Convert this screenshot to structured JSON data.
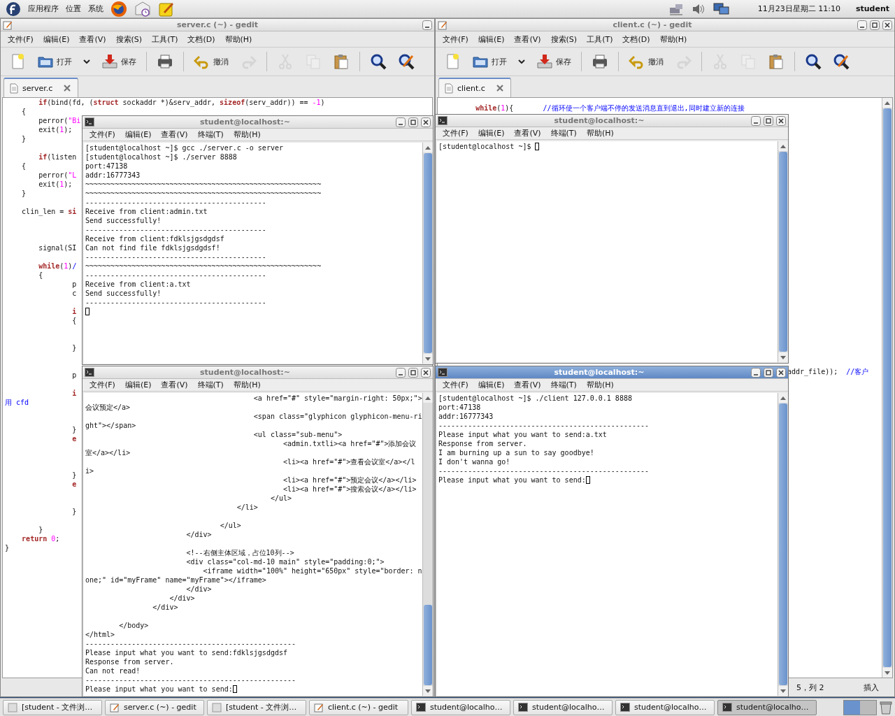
{
  "top_panel": {
    "menus": [
      "应用程序",
      "位置",
      "系统"
    ],
    "launchers": [
      {
        "kind": "browser"
      },
      {
        "kind": "mail"
      },
      {
        "kind": "notes"
      }
    ],
    "tray": [
      {
        "kind": "network"
      },
      {
        "kind": "volume"
      },
      {
        "kind": "display"
      }
    ],
    "clock": "11月23日星期二 11:10",
    "user": "student"
  },
  "gedit_windows": [
    {
      "title": "server.c (~) - gedit",
      "controls": [
        {
          "kind": "minimize"
        }
      ],
      "menus": [
        "文件(F)",
        "编辑(E)",
        "查看(V)",
        "搜索(S)",
        "工具(T)",
        "文档(D)",
        "帮助(H)"
      ],
      "toolbar": [
        [
          {
            "kind": "new",
            "disabled": false
          },
          {
            "kind": "open",
            "label": "打开",
            "disabled": false
          },
          {
            "kind": "dropdown",
            "disabled": false
          },
          {
            "kind": "save",
            "label": "保存",
            "disabled": false
          }
        ],
        [
          {
            "kind": "print",
            "disabled": false
          }
        ],
        [
          {
            "kind": "undo",
            "label": "撤消",
            "disabled": false
          },
          {
            "kind": "redo",
            "disabled": true
          }
        ],
        [
          {
            "kind": "cut",
            "disabled": true
          },
          {
            "kind": "copy",
            "disabled": true
          },
          {
            "kind": "paste",
            "disabled": false
          }
        ],
        [
          {
            "kind": "find",
            "disabled": false
          },
          {
            "kind": "replace",
            "disabled": false
          }
        ]
      ],
      "tab": {
        "label": "server.c"
      },
      "code": [
        {
          "kind": "code",
          "segments": [
            {
              "kind": "keyword",
              "text": "        if"
            },
            {
              "kind": "plain",
              "text": "(bind(fd, ("
            },
            {
              "kind": "keyword",
              "text": "struct"
            },
            {
              "kind": "plain",
              "text": " sockaddr *)&serv_addr, "
            },
            {
              "kind": "keyword",
              "text": "sizeof"
            },
            {
              "kind": "plain",
              "text": "(serv_addr)) == "
            },
            {
              "kind": "number",
              "text": "-1"
            },
            {
              "kind": "plain",
              "text": ")"
            }
          ]
        },
        {
          "kind": "code",
          "segments": [
            {
              "kind": "plain",
              "text": "    {"
            }
          ]
        },
        {
          "kind": "code",
          "segments": [
            {
              "kind": "plain",
              "text": "        perror("
            },
            {
              "kind": "string",
              "text": "\"Bi"
            }
          ]
        },
        {
          "kind": "code",
          "segments": [
            {
              "kind": "plain",
              "text": "        exit("
            },
            {
              "kind": "number",
              "text": "1"
            },
            {
              "kind": "plain",
              "text": ");"
            }
          ]
        },
        {
          "kind": "code",
          "segments": [
            {
              "kind": "plain",
              "text": "    }"
            }
          ]
        },
        {
          "kind": "blank"
        },
        {
          "kind": "code",
          "segments": [
            {
              "kind": "keyword",
              "text": "        if"
            },
            {
              "kind": "plain",
              "text": "(listen"
            }
          ]
        },
        {
          "kind": "code",
          "segments": [
            {
              "kind": "plain",
              "text": "    {"
            }
          ]
        },
        {
          "kind": "code",
          "segments": [
            {
              "kind": "plain",
              "text": "        perror("
            },
            {
              "kind": "string",
              "text": "\"L"
            }
          ]
        },
        {
          "kind": "code",
          "segments": [
            {
              "kind": "plain",
              "text": "        exit("
            },
            {
              "kind": "number",
              "text": "1"
            },
            {
              "kind": "plain",
              "text": ");"
            }
          ]
        },
        {
          "kind": "code",
          "segments": [
            {
              "kind": "plain",
              "text": "    }"
            }
          ]
        },
        {
          "kind": "blank"
        },
        {
          "kind": "code",
          "segments": [
            {
              "kind": "plain",
              "text": "    clin_len = "
            },
            {
              "kind": "keyword",
              "text": "si"
            }
          ]
        },
        {
          "kind": "blank"
        },
        {
          "kind": "blank"
        },
        {
          "kind": "blank"
        },
        {
          "kind": "code",
          "segments": [
            {
              "kind": "plain",
              "text": "        signal(SI"
            }
          ]
        },
        {
          "kind": "blank"
        },
        {
          "kind": "code",
          "segments": [
            {
              "kind": "keyword",
              "text": "        while"
            },
            {
              "kind": "plain",
              "text": "("
            },
            {
              "kind": "number",
              "text": "1"
            },
            {
              "kind": "plain",
              "text": ")"
            },
            {
              "kind": "comment",
              "text": "/"
            }
          ]
        },
        {
          "kind": "code",
          "segments": [
            {
              "kind": "plain",
              "text": "        {"
            }
          ]
        },
        {
          "kind": "code",
          "segments": [
            {
              "kind": "plain",
              "text": "                p"
            }
          ]
        },
        {
          "kind": "code",
          "segments": [
            {
              "kind": "plain",
              "text": "                c"
            }
          ]
        },
        {
          "kind": "blank"
        },
        {
          "kind": "code",
          "segments": [
            {
              "kind": "keyword",
              "text": "                i"
            }
          ]
        },
        {
          "kind": "code",
          "segments": [
            {
              "kind": "plain",
              "text": "                {"
            }
          ]
        },
        {
          "kind": "blank"
        },
        {
          "kind": "blank"
        },
        {
          "kind": "code",
          "segments": [
            {
              "kind": "plain",
              "text": "                }"
            }
          ]
        },
        {
          "kind": "blank"
        },
        {
          "kind": "blank"
        },
        {
          "kind": "code",
          "segments": [
            {
              "kind": "plain",
              "text": "                p"
            }
          ]
        },
        {
          "kind": "blank"
        },
        {
          "kind": "code",
          "segments": [
            {
              "kind": "keyword",
              "text": "                i"
            }
          ]
        },
        {
          "kind": "code",
          "segments": [
            {
              "kind": "comment",
              "text": "用 cfd"
            }
          ]
        },
        {
          "kind": "blank"
        },
        {
          "kind": "blank"
        },
        {
          "kind": "code",
          "segments": [
            {
              "kind": "plain",
              "text": "                }"
            }
          ]
        },
        {
          "kind": "code",
          "segments": [
            {
              "kind": "keyword",
              "text": "                e"
            }
          ]
        },
        {
          "kind": "blank"
        },
        {
          "kind": "blank"
        },
        {
          "kind": "blank"
        },
        {
          "kind": "code",
          "segments": [
            {
              "kind": "plain",
              "text": "                }"
            }
          ]
        },
        {
          "kind": "code",
          "segments": [
            {
              "kind": "keyword",
              "text": "                e"
            }
          ]
        },
        {
          "kind": "blank"
        },
        {
          "kind": "blank"
        },
        {
          "kind": "code",
          "segments": [
            {
              "kind": "plain",
              "text": "                }"
            }
          ]
        },
        {
          "kind": "blank"
        },
        {
          "kind": "code",
          "segments": [
            {
              "kind": "plain",
              "text": "        }"
            }
          ]
        },
        {
          "kind": "code",
          "segments": [
            {
              "kind": "keyword",
              "text": "    return"
            },
            {
              "kind": "number",
              "text": " 0"
            },
            {
              "kind": "plain",
              "text": ";"
            }
          ]
        },
        {
          "kind": "code",
          "segments": [
            {
              "kind": "plain",
              "text": "}"
            }
          ]
        }
      ]
    },
    {
      "title": "client.c (~) - gedit",
      "controls": [
        {
          "kind": "minimize"
        },
        {
          "kind": "maximize"
        },
        {
          "kind": "close"
        }
      ],
      "menus": [
        "文件(F)",
        "编辑(E)",
        "查看(V)",
        "搜索(S)",
        "工具(T)",
        "文档(D)",
        "帮助(H)"
      ],
      "toolbar": [
        [
          {
            "kind": "new",
            "disabled": false
          },
          {
            "kind": "open",
            "label": "打开",
            "disabled": false
          },
          {
            "kind": "dropdown",
            "disabled": false
          },
          {
            "kind": "save",
            "label": "保存",
            "disabled": false
          }
        ],
        [
          {
            "kind": "print",
            "disabled": false
          }
        ],
        [
          {
            "kind": "undo",
            "label": "撤消",
            "disabled": false
          },
          {
            "kind": "redo",
            "disabled": true
          }
        ],
        [
          {
            "kind": "cut",
            "disabled": true
          },
          {
            "kind": "copy",
            "disabled": true
          },
          {
            "kind": "paste",
            "disabled": false
          }
        ],
        [
          {
            "kind": "find",
            "disabled": false
          },
          {
            "kind": "replace",
            "disabled": false
          }
        ]
      ],
      "tab": {
        "label": "client.c"
      },
      "code": [
        {
          "kind": "code",
          "segments": [
            {
              "kind": "keyword",
              "text": "        while"
            },
            {
              "kind": "plain",
              "text": "("
            },
            {
              "kind": "number",
              "text": "1"
            },
            {
              "kind": "plain",
              "text": "){       "
            },
            {
              "kind": "comment",
              "text": "//循环使一个客户端不停的发送消息直到退出,同时建立新的连接"
            }
          ]
        },
        {
          "kind": "blank"
        },
        {
          "kind": "blank"
        },
        {
          "kind": "blank"
        },
        {
          "kind": "blank"
        },
        {
          "kind": "blank"
        },
        {
          "kind": "blank"
        },
        {
          "kind": "blank"
        },
        {
          "kind": "blank"
        },
        {
          "kind": "blank"
        },
        {
          "kind": "blank"
        },
        {
          "kind": "blank"
        },
        {
          "kind": "blank"
        },
        {
          "kind": "blank"
        },
        {
          "kind": "blank"
        },
        {
          "kind": "blank"
        },
        {
          "kind": "blank"
        },
        {
          "kind": "blank"
        },
        {
          "kind": "blank"
        },
        {
          "kind": "blank"
        },
        {
          "kind": "blank"
        },
        {
          "kind": "blank"
        },
        {
          "kind": "blank"
        },
        {
          "kind": "blank"
        },
        {
          "kind": "blank"
        },
        {
          "kind": "blank"
        },
        {
          "kind": "blank"
        },
        {
          "kind": "blank"
        },
        {
          "kind": "blank"
        },
        {
          "kind": "tail",
          "segments": [
            {
              "kind": "plain",
              "text": "addr_file));  "
            },
            {
              "kind": "comment",
              "text": "//客户"
            }
          ]
        }
      ],
      "status": [
        "5，列 2",
        "插入"
      ]
    }
  ],
  "terminals": [
    {
      "title": "student@localhost:~",
      "active": false,
      "has_scrollback": false,
      "menus": [
        "文件(F)",
        "编辑(E)",
        "查看(V)",
        "终端(T)",
        "帮助(H)"
      ],
      "lines": [
        {
          "kind": "text",
          "text": "[student@localhost ~]$ gcc ./server.c -o server"
        },
        {
          "kind": "text",
          "text": "[student@localhost ~]$ ./server 8888"
        },
        {
          "kind": "text",
          "text": "port:47138"
        },
        {
          "kind": "text",
          "text": "addr:16777343"
        },
        {
          "kind": "text",
          "text": "~~~~~~~~~~~~~~~~~~~~~~~~~~~~~~~~~~~~~~~~~~~~~~~~~~~~~~~~"
        },
        {
          "kind": "text",
          "text": "~~~~~~~~~~~~~~~~~~~~~~~~~~~~~~~~~~~~~~~~~~~~~~~~~~~~~~~~"
        },
        {
          "kind": "text",
          "text": "-------------------------------------------"
        },
        {
          "kind": "text",
          "text": "Receive from client:admin.txt"
        },
        {
          "kind": "text",
          "text": "Send successfully!"
        },
        {
          "kind": "text",
          "text": "-------------------------------------------"
        },
        {
          "kind": "text",
          "text": "Receive from client:fdklsjgsdgdsf"
        },
        {
          "kind": "text",
          "text": "Can not find file fdklsjgsdgdsf!"
        },
        {
          "kind": "text",
          "text": "-------------------------------------------"
        },
        {
          "kind": "text",
          "text": "~~~~~~~~~~~~~~~~~~~~~~~~~~~~~~~~~~~~~~~~~~~~~~~~~~~~~~~~"
        },
        {
          "kind": "text",
          "text": "-------------------------------------------"
        },
        {
          "kind": "text",
          "text": "Receive from client:a.txt"
        },
        {
          "kind": "text",
          "text": "Send successfully!"
        },
        {
          "kind": "text",
          "text": "-------------------------------------------"
        },
        {
          "kind": "blank"
        }
      ]
    },
    {
      "title": "student@localhost:~",
      "active": false,
      "has_scrollback": false,
      "menus": [
        "文件(F)",
        "编辑(E)",
        "查看(V)",
        "终端(T)",
        "帮助(H)"
      ],
      "lines": [
        {
          "kind": "text",
          "text": "[student@localhost ~]$ "
        }
      ]
    },
    {
      "title": "student@localhost:~",
      "active": false,
      "has_scrollback": true,
      "menus": [
        "文件(F)",
        "编辑(E)",
        "查看(V)",
        "终端(T)",
        "帮助(H)"
      ],
      "lines": [
        {
          "kind": "text",
          "text": "                                        <a href=\"#\" style=\"margin-right: 50px;\">"
        },
        {
          "kind": "text",
          "text": "会议预定</a>"
        },
        {
          "kind": "text",
          "text": "                                        <span class=\"glyphicon glyphicon-menu-ri"
        },
        {
          "kind": "text",
          "text": "ght\"></span>"
        },
        {
          "kind": "text",
          "text": "                                        <ul class=\"sub-menu\">"
        },
        {
          "kind": "text",
          "text": "                                               <admin.txtli><a href=\"#\">添加会议"
        },
        {
          "kind": "text",
          "text": "室</a></li>"
        },
        {
          "kind": "text",
          "text": "                                               <li><a href=\"#\">查看会议室</a></l"
        },
        {
          "kind": "text",
          "text": "i>"
        },
        {
          "kind": "text",
          "text": "                                               <li><a href=\"#\">预定会议</a></li>"
        },
        {
          "kind": "text",
          "text": "                                               <li><a href=\"#\">搜索会议</a></li>"
        },
        {
          "kind": "text",
          "text": "                                            </ul>"
        },
        {
          "kind": "text",
          "text": "                                    </li>"
        },
        {
          "kind": "blank"
        },
        {
          "kind": "text",
          "text": "                                </ul>"
        },
        {
          "kind": "text",
          "text": "                        </div>"
        },
        {
          "kind": "blank"
        },
        {
          "kind": "text",
          "text": "                        <!--右侧主体区域，占位10列-->"
        },
        {
          "kind": "text",
          "text": "                        <div class=\"col-md-10 main\" style=\"padding:0;\">"
        },
        {
          "kind": "text",
          "text": "                            <iframe width=\"100%\" height=\"650px\" style=\"border: n"
        },
        {
          "kind": "text",
          "text": "one;\" id=\"myFrame\" name=\"myFrame\"></iframe>"
        },
        {
          "kind": "text",
          "text": "                        </div>"
        },
        {
          "kind": "text",
          "text": "                    </div>"
        },
        {
          "kind": "text",
          "text": "                </div>"
        },
        {
          "kind": "blank"
        },
        {
          "kind": "text",
          "text": "        </body>"
        },
        {
          "kind": "text",
          "text": "</html>"
        },
        {
          "kind": "text",
          "text": "--------------------------------------------------"
        },
        {
          "kind": "text",
          "text": "Please input what you want to send:fdklsjgsdgdsf"
        },
        {
          "kind": "text",
          "text": "Response from server."
        },
        {
          "kind": "text",
          "text": "Can not read!"
        },
        {
          "kind": "text",
          "text": "--------------------------------------------------"
        },
        {
          "kind": "text",
          "text": "Please input what you want to send:"
        }
      ]
    },
    {
      "title": "student@localhost:~",
      "active": true,
      "has_scrollback": false,
      "menus": [
        "文件(F)",
        "编辑(E)",
        "查看(V)",
        "终端(T)",
        "帮助(H)"
      ],
      "lines": [
        {
          "kind": "text",
          "text": "[student@localhost ~]$ ./client 127.0.0.1 8888"
        },
        {
          "kind": "text",
          "text": "port:47138"
        },
        {
          "kind": "text",
          "text": "addr:16777343"
        },
        {
          "kind": "text",
          "text": "--------------------------------------------------"
        },
        {
          "kind": "text",
          "text": "Please input what you want to send:a.txt"
        },
        {
          "kind": "text",
          "text": "Response from server."
        },
        {
          "kind": "text",
          "text": "I am burning up a sun to say goodbye!"
        },
        {
          "kind": "text",
          "text": "I don't wanna go!"
        },
        {
          "kind": "text",
          "text": "--------------------------------------------------"
        },
        {
          "kind": "text",
          "text": "Please input what you want to send:"
        }
      ]
    }
  ],
  "taskbar": [
    {
      "label": "[student - 文件浏…",
      "kind": "folder",
      "selected": false
    },
    {
      "label": "server.c (~) - gedit",
      "kind": "editor",
      "selected": false
    },
    {
      "label": "[student - 文件浏…",
      "kind": "folder",
      "selected": false
    },
    {
      "label": "client.c (~) - gedit",
      "kind": "editor",
      "selected": false
    },
    {
      "label": "student@localho…",
      "kind": "terminal",
      "selected": false
    },
    {
      "label": "student@localho…",
      "kind": "terminal",
      "selected": false
    },
    {
      "label": "student@localho…",
      "kind": "terminal",
      "selected": false
    },
    {
      "label": "student@localho…",
      "kind": "terminal",
      "selected": true
    }
  ]
}
